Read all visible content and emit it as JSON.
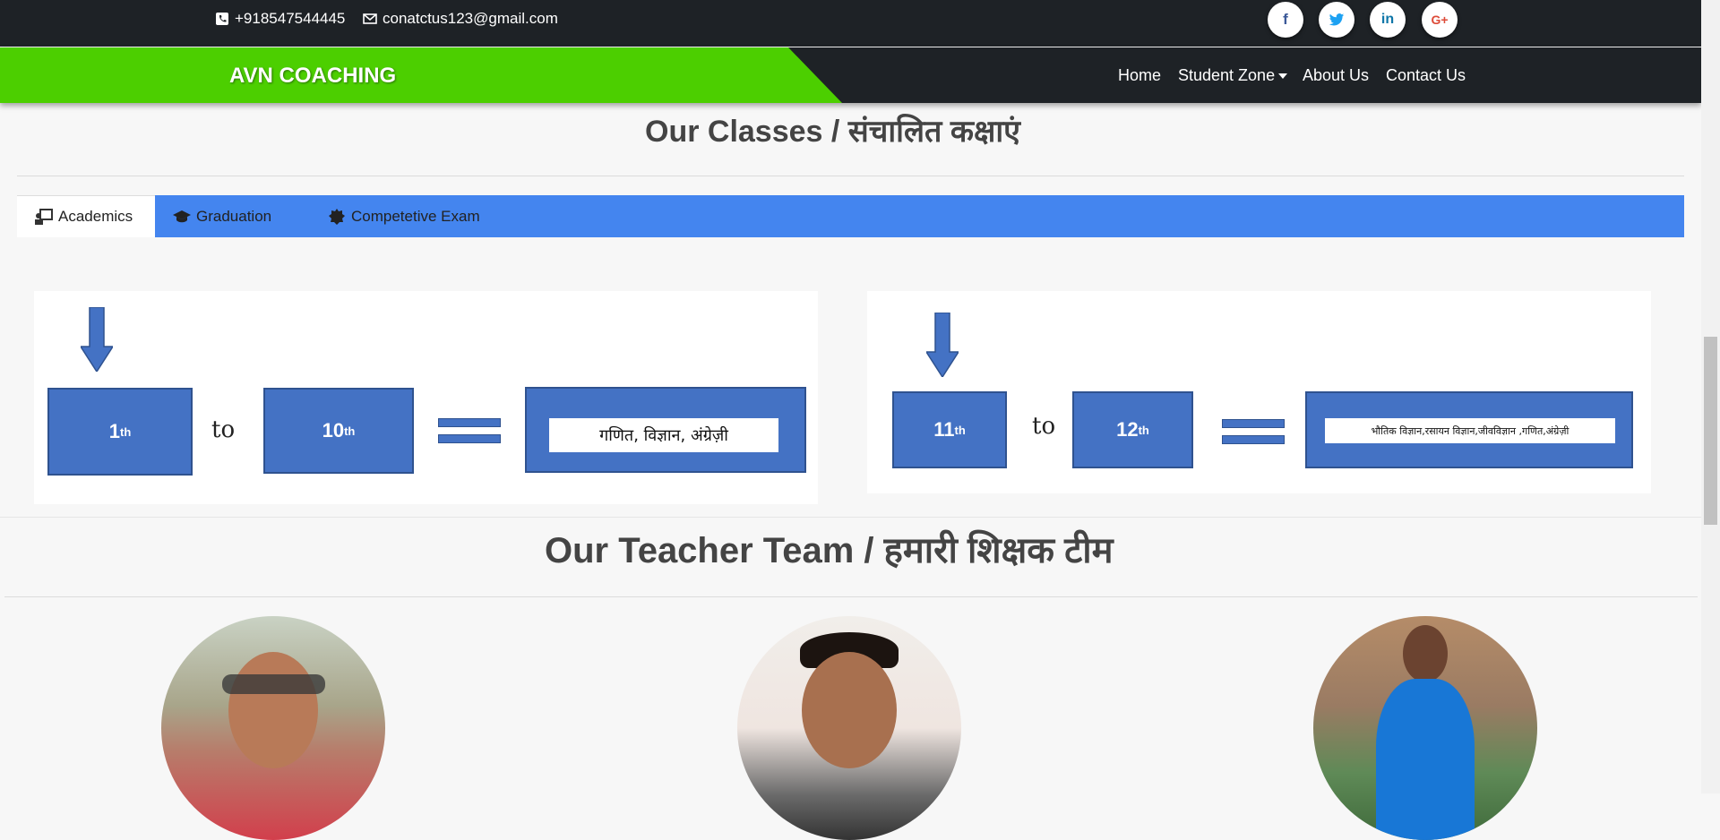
{
  "topbar": {
    "phone": "+918547544445",
    "email": "conatctus123@gmail.com",
    "social": [
      {
        "icon": "facebook-icon",
        "glyph": "f"
      },
      {
        "icon": "twitter-icon",
        "glyph": "t"
      },
      {
        "icon": "linkedin-icon",
        "glyph": "in"
      },
      {
        "icon": "google-plus-icon",
        "glyph": "G+"
      }
    ]
  },
  "navbar": {
    "brand": "AVN COACHING",
    "links": [
      "Home",
      "Student Zone",
      "About Us",
      "Contact Us"
    ]
  },
  "classes": {
    "title": "Our Classes / संचालित कक्षाएं",
    "tabs": [
      "Academics",
      "Graduation",
      "Competetive Exam"
    ],
    "card1": {
      "from": "1",
      "from_sup": "th",
      "connector": "to",
      "to": "10",
      "to_sup": "th",
      "subjects": "गणित,  विज्ञान, अंग्रेज़ी"
    },
    "card2": {
      "from": "11",
      "from_sup": "th",
      "connector": "to",
      "to": "12",
      "to_sup": "th",
      "subjects": "भौतिक विज्ञान,रसायन विज्ञान,जीवविज्ञान ,गणित,अंग्रेज़ी"
    }
  },
  "team": {
    "title": "Our Teacher Team / हमारी शिक्षक टीम"
  },
  "colors": {
    "dark": "#1e2226",
    "brand_green": "#4ccf00",
    "tab_blue": "#4485ef",
    "box_blue": "#4472c4"
  }
}
